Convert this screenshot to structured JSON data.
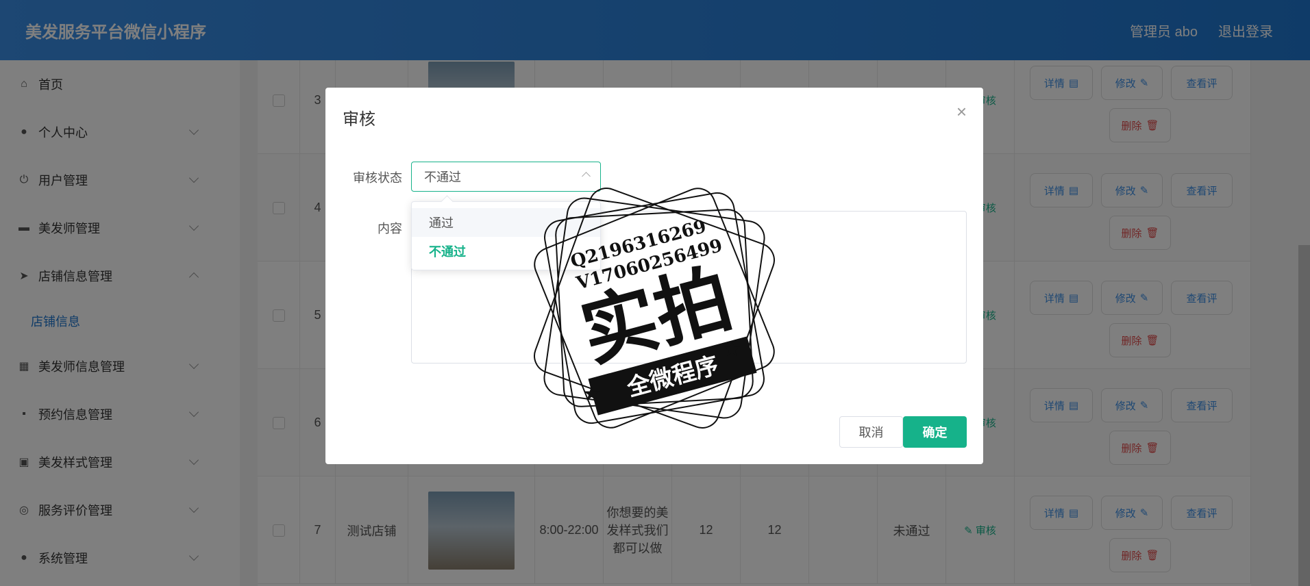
{
  "header": {
    "title": "美发服务平台微信小程序",
    "user": "管理员 abo",
    "logout": "退出登录"
  },
  "sidebar": {
    "items": [
      {
        "label": "首页",
        "icon": "home-icon",
        "chev": ""
      },
      {
        "label": "个人中心",
        "icon": "user-icon",
        "chev": "down"
      },
      {
        "label": "用户管理",
        "icon": "power-icon",
        "chev": "down"
      },
      {
        "label": "美发师管理",
        "icon": "briefcase-icon",
        "chev": "down"
      },
      {
        "label": "店铺信息管理",
        "icon": "send-icon",
        "chev": "up"
      },
      {
        "label": "美发师信息管理",
        "icon": "grid-icon",
        "chev": "down"
      },
      {
        "label": "预约信息管理",
        "icon": "chat-icon",
        "chev": "down"
      },
      {
        "label": "美发样式管理",
        "icon": "clipboard-icon",
        "chev": "down"
      },
      {
        "label": "服务评价管理",
        "icon": "compass-icon",
        "chev": "down"
      },
      {
        "label": "系统管理",
        "icon": "user-icon",
        "chev": "down"
      }
    ],
    "submenu": "店铺信息"
  },
  "table": {
    "rows": [
      {
        "num": "3",
        "name": "",
        "hours": "",
        "desc": "",
        "c1": "",
        "c2": "",
        "status": ""
      },
      {
        "num": "4",
        "name": "",
        "hours": "",
        "desc": "",
        "c1": "",
        "c2": "",
        "status": ""
      },
      {
        "num": "5",
        "name": "",
        "hours": "",
        "desc": "",
        "c1": "",
        "c2": "",
        "status": ""
      },
      {
        "num": "6",
        "name": "",
        "hours": "",
        "desc": "",
        "c1": "",
        "c2": "",
        "status": ""
      },
      {
        "num": "7",
        "name": "测试店铺",
        "hours": "8:00-22:00",
        "desc": "你想要的美发样式我们都可以做",
        "c1": "12",
        "c2": "12",
        "status": "未通过"
      }
    ],
    "audit": "审核",
    "detail": "详情",
    "edit": "修改",
    "view": "查看评",
    "delete": "删除"
  },
  "modal": {
    "title": "审核",
    "status_label": "审核状态",
    "status_value": "不通过",
    "options": [
      "通过",
      "不通过"
    ],
    "content_label": "内容",
    "cancel": "取消",
    "confirm": "确定"
  },
  "watermark": {
    "line1": "Q2196316269",
    "line2": "V17060256499",
    "main": "实拍",
    "ribbon": "全微程序"
  },
  "colors": {
    "header": "#1f77d0",
    "accent": "#16b28a",
    "danger": "#e04848"
  }
}
